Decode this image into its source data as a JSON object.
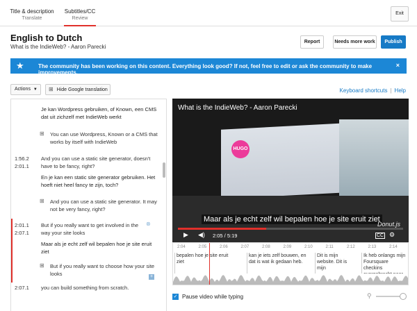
{
  "tabs": [
    {
      "title": "Title & description",
      "sub": "Translate"
    },
    {
      "title": "Subtitles/CC",
      "sub": "Review"
    }
  ],
  "exit_label": "Exit",
  "page": {
    "title": "English to Dutch",
    "subtitle": "What is the IndieWeb? - Aaron Parecki"
  },
  "actions": {
    "report": "Report",
    "needs_more_work": "Needs more work",
    "publish": "Publish"
  },
  "banner": {
    "message": "The community has been working on this content. Everything look good? If not, feel free to edit or ask the community to make improvements.",
    "close": "×"
  },
  "toolbar": {
    "actions_label": "Actions",
    "hide_translation": "Hide Google translation"
  },
  "links": {
    "keyboard": "Keyboard shortcuts",
    "help": "Help"
  },
  "entries": {
    "e0": {
      "dst": "Je kan Wordpress gebruiken, of Known, een CMS dat uit zichzelf met IndieWeb werkt",
      "gt": "You can use Wordpress, Known or a CMS that works by itself with IndieWeb"
    },
    "e1": {
      "ts1": "1:56.2",
      "ts2": "2:01.1",
      "src": "And you can use a static site generator, doesn't have to be fancy, right?",
      "dst": "En je kan een static site generator gebruiken. Het hoeft niet heel fancy te zijn, toch?",
      "gt": "And you can use a static site generator. It may not be very fancy, right?"
    },
    "e2": {
      "ts1": "2:01.1",
      "ts2": "2:07.1",
      "src": "But if you really want to get involved in the way your site looks",
      "dst": "Maar als je echt zelf wil bepalen hoe je site eruit ziet",
      "gt": "But if you really want to choose how your site looks"
    },
    "e3": {
      "ts1": "2:07.1",
      "src": "you can build something from scratch."
    }
  },
  "video": {
    "title": "What is the IndieWeb? - Aaron Parecki",
    "caption": "Maar als je echt zelf wil bepalen hoe je site eruit ziet",
    "watermark": "Donut.js",
    "time": "2:05 / 5:19",
    "logo_text": "HUGO",
    "progress": 0.392
  },
  "timeline": {
    "ticks": [
      "2:04",
      "2:05",
      "2:06",
      "2:07",
      "2:08",
      "2:09",
      "2:10",
      "2:11",
      "2:12",
      "2:13",
      "2:14"
    ],
    "cues": [
      "bepalen hoe je site eruit ziet",
      "kan je iets zelf bouwen, en dat is wat ik gedaan heb.",
      "Dit is mijn website. Dit is mijn",
      "Ik heb onlangs mijn Foursquare checkins overgebracht naar mijn eigen site"
    ]
  },
  "pause_label": "Pause video while typing"
}
